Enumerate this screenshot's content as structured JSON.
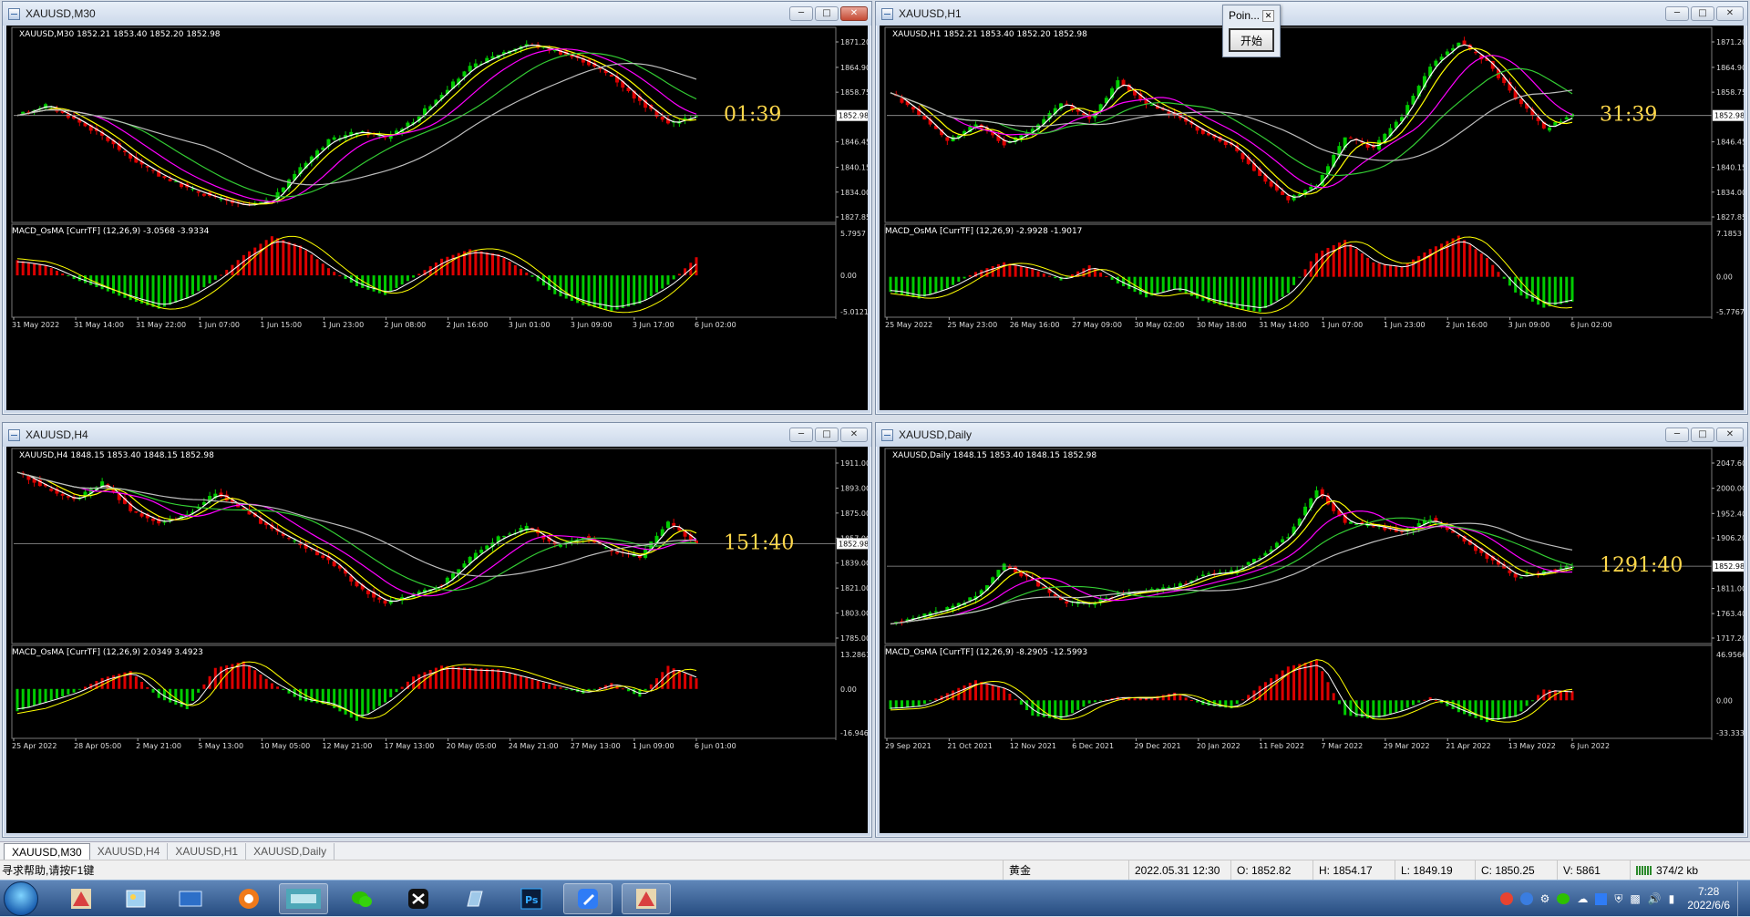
{
  "windows": [
    {
      "title": "XAUUSD,M30",
      "symbol_line": "XAUUSD,M30  1852.21 1853.40 1852.20 1852.98",
      "countdown": "01:39",
      "macd_label": "MACD_OsMA [CurrTF] (12,26,9) -3.0568 -3.9334",
      "current_price": "1852.98",
      "close_active": true
    },
    {
      "title": "XAUUSD,H1",
      "symbol_line": "XAUUSD,H1  1852.21 1853.40 1852.20 1852.98",
      "countdown": "31:39",
      "macd_label": "MACD_OsMA [CurrTF] (12,26,9) -2.9928 -1.9017",
      "current_price": "1852.98",
      "close_active": false
    },
    {
      "title": "XAUUSD,H4",
      "symbol_line": "XAUUSD,H4  1848.15 1853.40 1848.15 1852.98",
      "countdown": "151:40",
      "macd_label": "MACD_OsMA [CurrTF] (12,26,9) 2.0349 3.4923",
      "current_price": "1852.98",
      "close_active": false
    },
    {
      "title": "XAUUSD,Daily",
      "symbol_line": "XAUUSD,Daily  1848.15 1853.40 1848.15 1852.98",
      "countdown": "1291:40",
      "macd_label": "MACD_OsMA [CurrTF] (12,26,9) -8.2905 -12.5993",
      "current_price": "1852.98",
      "close_active": false
    }
  ],
  "chart_data": [
    {
      "type": "line",
      "title": "XAUUSD,M30",
      "ylim": [
        1827.85,
        1871.2
      ],
      "y_ticks": [
        "1871.20",
        "1864.90",
        "1858.75",
        "1852.98",
        "1846.45",
        "1840.15",
        "1834.00",
        "1827.85"
      ],
      "x_ticks": [
        "31 May 2022",
        "31 May 14:00",
        "31 May 22:00",
        "1 Jun 07:00",
        "1 Jun 15:00",
        "1 Jun 23:00",
        "2 Jun 08:00",
        "2 Jun 16:00",
        "3 Jun 01:00",
        "3 Jun 09:00",
        "3 Jun 17:00",
        "6 Jun 02:00"
      ],
      "macd_ticks": [
        "5.7957",
        "0.00",
        "-5.0121"
      ],
      "series": [
        {
          "values": [
            1853.0,
            1855.6,
            1852.1,
            1847.9,
            1842.4,
            1838.2,
            1835.0,
            1832.5,
            1830.6,
            1831.9,
            1840.3,
            1846.7,
            1849.0,
            1847.6,
            1851.7,
            1858.4,
            1864.9,
            1868.2,
            1870.7,
            1869.0,
            1866.5,
            1862.7,
            1856.3,
            1850.9,
            1852.98
          ]
        }
      ],
      "macd": [
        2.1,
        1.4,
        -0.5,
        -1.9,
        -3.4,
        -4.6,
        -3.2,
        -0.6,
        2.8,
        5.4,
        4.1,
        1.0,
        -1.5,
        -2.7,
        -0.3,
        2.3,
        3.6,
        2.9,
        0.4,
        -2.6,
        -4.1,
        -4.9,
        -3.9,
        -1.3,
        2.5
      ]
    },
    {
      "type": "line",
      "title": "XAUUSD,H1",
      "ylim": [
        1827.85,
        1871.2
      ],
      "y_ticks": [
        "1871.20",
        "1864.90",
        "1858.75",
        "1852.98",
        "1846.45",
        "1840.15",
        "1834.00",
        "1827.85"
      ],
      "x_ticks": [
        "25 May 2022",
        "25 May 23:00",
        "26 May 16:00",
        "27 May 09:00",
        "30 May 02:00",
        "30 May 18:00",
        "31 May 14:00",
        "1 Jun 07:00",
        "1 Jun 23:00",
        "2 Jun 16:00",
        "3 Jun 09:00",
        "6 Jun 02:00"
      ],
      "macd_ticks": [
        "7.1853",
        "0.00",
        "-5.7767"
      ],
      "series": [
        {
          "values": [
            1858.6,
            1853.3,
            1846.5,
            1851.0,
            1845.8,
            1849.5,
            1856.3,
            1852.1,
            1861.5,
            1855.8,
            1853.0,
            1848.7,
            1845.4,
            1838.2,
            1832.1,
            1835.9,
            1847.6,
            1844.9,
            1852.9,
            1865.3,
            1871.2,
            1866.1,
            1857.4,
            1849.6,
            1852.98
          ]
        }
      ],
      "macd": [
        -2.5,
        -3.6,
        -1.9,
        0.8,
        2.4,
        1.3,
        -0.6,
        1.9,
        -1.1,
        -3.4,
        -2.0,
        -4.0,
        -5.1,
        -5.8,
        -2.7,
        3.9,
        6.1,
        2.4,
        1.7,
        4.6,
        6.8,
        3.1,
        -2.6,
        -5.1,
        -4.1
      ]
    },
    {
      "type": "line",
      "title": "XAUUSD,H4",
      "ylim": [
        1785.0,
        1911.0
      ],
      "y_ticks": [
        "1911.00",
        "1893.00",
        "1875.00",
        "1857.00",
        "1852.98",
        "1839.00",
        "1821.00",
        "1803.00",
        "1785.00"
      ],
      "x_ticks": [
        "25 Apr 2022",
        "28 Apr 05:00",
        "2 May 21:00",
        "5 May 13:00",
        "10 May 05:00",
        "12 May 21:00",
        "17 May 13:00",
        "20 May 05:00",
        "24 May 21:00",
        "27 May 13:00",
        "1 Jun 09:00",
        "6 Jun 01:00"
      ],
      "macd_ticks": [
        "13.2861",
        "0.00",
        "-16.9466"
      ],
      "series": [
        {
          "values": [
            1904.3,
            1893.5,
            1884.2,
            1896.8,
            1877.4,
            1868.1,
            1873.9,
            1889.7,
            1877.1,
            1862.6,
            1851.9,
            1841.5,
            1822.6,
            1810.3,
            1816.7,
            1823.5,
            1842.3,
            1857.1,
            1864.9,
            1851.6,
            1857.4,
            1847.3,
            1843.5,
            1868.2,
            1852.98
          ]
        }
      ],
      "macd": [
        -8.6,
        -5.1,
        -1.4,
        4.2,
        6.9,
        -3.5,
        -7.8,
        8.1,
        10.6,
        2.2,
        -4.4,
        -6.2,
        -12.3,
        -5.2,
        4.8,
        9.0,
        8.1,
        7.6,
        4.4,
        1.2,
        -1.8,
        2.3,
        -3.0,
        8.9,
        4.1
      ]
    },
    {
      "type": "line",
      "title": "XAUUSD,Daily",
      "ylim": [
        1717.2,
        2047.6
      ],
      "y_ticks": [
        "2047.60",
        "2000.00",
        "1952.40",
        "1906.20",
        "1852.98",
        "1811.00",
        "1763.40",
        "1717.20"
      ],
      "x_ticks": [
        "29 Sep 2021",
        "21 Oct 2021",
        "12 Nov 2021",
        "6 Dec 2021",
        "29 Dec 2021",
        "20 Jan 2022",
        "11 Feb 2022",
        "7 Mar 2022",
        "29 Mar 2022",
        "21 Apr 2022",
        "13 May 2022",
        "6 Jun 2022"
      ],
      "macd_ticks": [
        "46.9566",
        "0.00",
        "-33.333"
      ],
      "series": [
        {
          "values": [
            1743.8,
            1758.2,
            1772.5,
            1796.3,
            1854.7,
            1824.9,
            1786.1,
            1781.6,
            1800.2,
            1806.3,
            1812.8,
            1836.4,
            1842.1,
            1869.9,
            1911.0,
            1997.6,
            1934.8,
            1929.3,
            1917.1,
            1941.5,
            1907.3,
            1869.8,
            1832.5,
            1841.6,
            1852.98
          ]
        }
      ],
      "macd": [
        -9.0,
        -6.3,
        7.4,
        20.6,
        12.4,
        -15.6,
        -19.8,
        -3.2,
        3.5,
        2.1,
        7.8,
        -4.6,
        -8.2,
        14.7,
        34.6,
        41.2,
        -15.1,
        -19.3,
        -10.4,
        3.2,
        -12.1,
        -22.3,
        -17.0,
        11.1,
        9.4
      ]
    }
  ],
  "tabs": [
    "XAUUSD,M30",
    "XAUUSD,H4",
    "XAUUSD,H1",
    "XAUUSD,Daily"
  ],
  "status": {
    "help": "寻求帮助,请按F1键",
    "profile": "黄金",
    "datetime": "2022.05.31 12:30",
    "open": "O: 1852.82",
    "high": "H: 1854.17",
    "low": "L: 1849.19",
    "close": "C: 1850.25",
    "volume": "V: 5861",
    "traffic": "374/2 kb"
  },
  "popup": {
    "title": "Poin...",
    "button": "开始"
  },
  "taskbar": {
    "time": "7:28",
    "date": "2022/6/6",
    "apps": [
      "map-app-icon",
      "photos-app-icon",
      "desktop-app-icon",
      "browser-app-icon",
      "game-app-icon",
      "wechat-icon",
      "capcut-icon",
      "notes-app-icon",
      "photoshop-icon",
      "feishu-icon",
      "metatrader-icon"
    ]
  },
  "colors": {
    "bull": "#00cc00",
    "bear": "#dd0000",
    "ma_fast": "#ffffff",
    "ma_yellow": "#ffff00",
    "ma_magenta": "#ff00ff",
    "ma_green": "#33cc33",
    "ma_gray": "#bdbdbd",
    "countdown": "#ffd84a",
    "grid": "#5a5a5a"
  }
}
